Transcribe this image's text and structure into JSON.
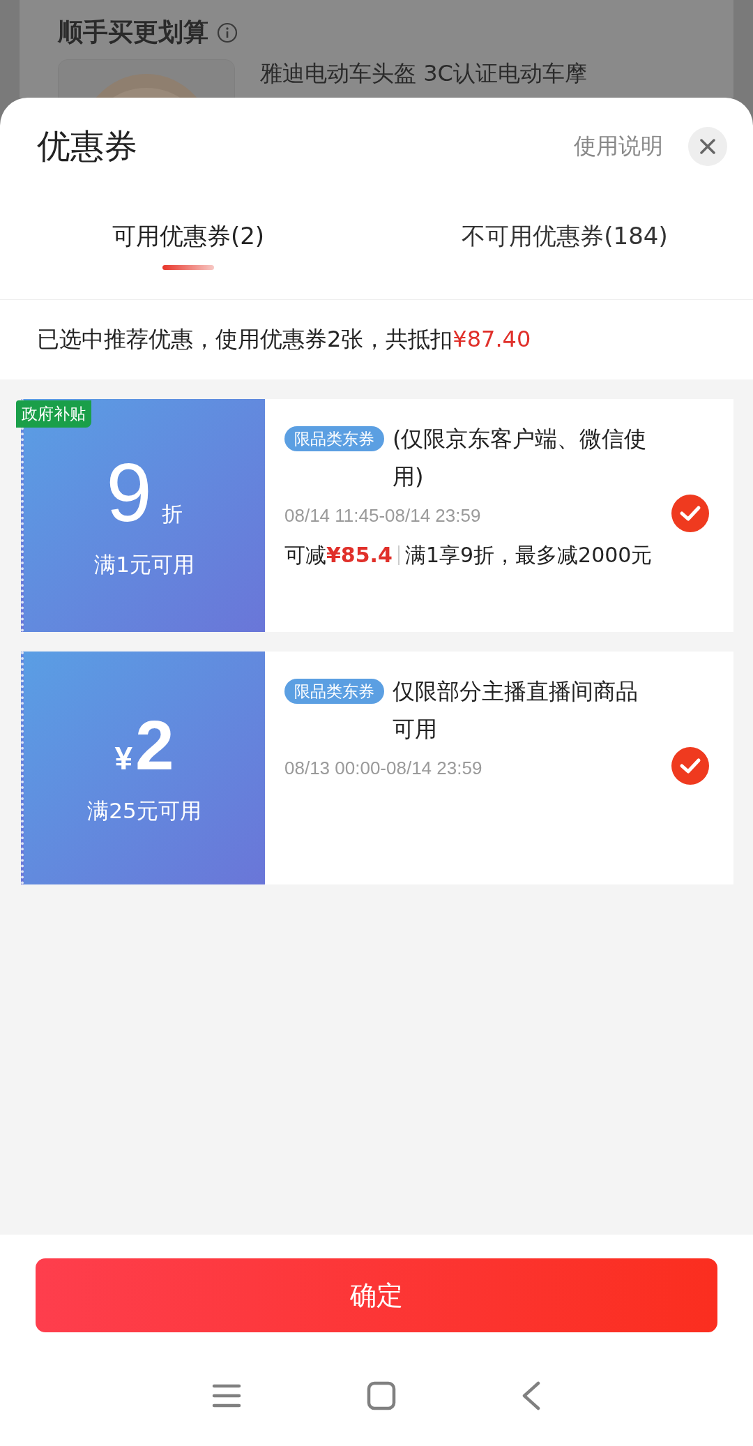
{
  "backdrop": {
    "section_title": "顺手买更划算",
    "product_title": "雅迪电动车头盔 3C认证电动车摩"
  },
  "sheet": {
    "title": "优惠券",
    "help_link": "使用说明"
  },
  "tabs": [
    {
      "label": "可用优惠券(2)",
      "selected": true
    },
    {
      "label": "不可用优惠券(184)",
      "selected": false
    }
  ],
  "summary": {
    "text": "已选中推荐优惠，使用优惠券2张，共抵扣",
    "amount": "¥87.40"
  },
  "coupons": [
    {
      "kind": "discount",
      "corner_tag": "政府补贴",
      "value": "9",
      "unit": "折",
      "condition": "满1元可用",
      "type_tag": "限品类东券",
      "title": "(仅限京东客户端、微信使用)",
      "validity": "08/14 11:45-08/14 23:59",
      "saving_label": "可减",
      "saving": "¥85.4",
      "rule": "满1享9折，最多减2000元",
      "selected": true
    },
    {
      "kind": "cash",
      "currency": "¥",
      "value": "2",
      "condition": "满25元可用",
      "type_tag": "限品类东券",
      "title": "仅限部分主播直播间商品可用",
      "validity": "08/13 00:00-08/14 23:59",
      "selected": true
    }
  ],
  "confirm_button": "确定"
}
